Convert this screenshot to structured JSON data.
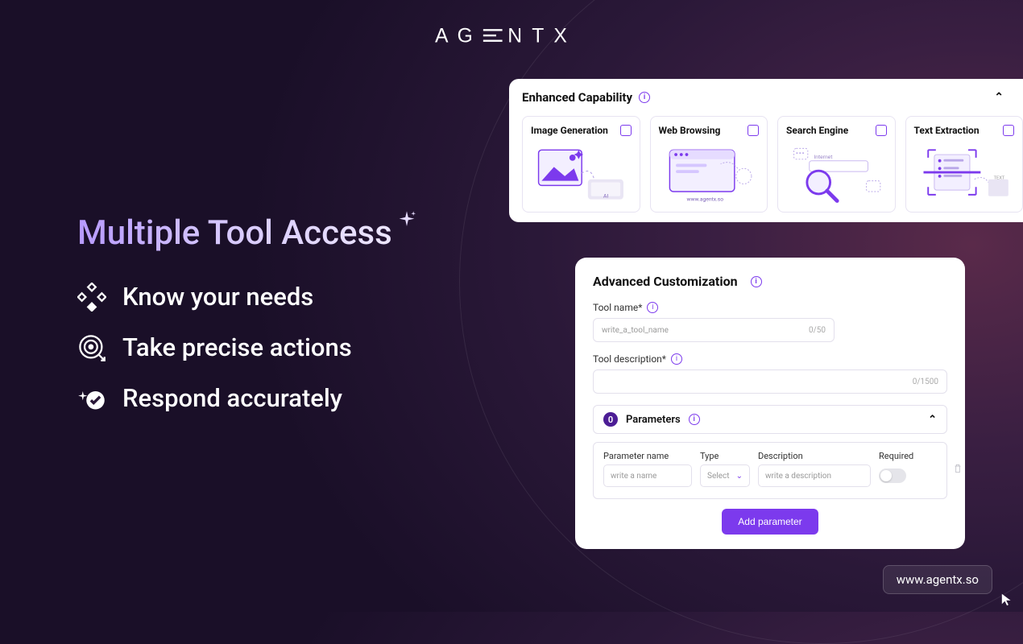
{
  "logo_text": "AGENTX",
  "headline": "Multiple Tool Access",
  "features": [
    {
      "text": "Know your needs"
    },
    {
      "text": "Take precise actions"
    },
    {
      "text": "Respond accurately"
    }
  ],
  "capability_panel": {
    "title": "Enhanced Capability",
    "cards": [
      {
        "label": "Image Generation",
        "sublabel": "AI"
      },
      {
        "label": "Web Browsing",
        "sublabel": "www.agentx.so"
      },
      {
        "label": "Search Engine",
        "sublabel": "Internet"
      },
      {
        "label": "Text Extraction",
        "sublabel": "TEXT"
      }
    ]
  },
  "adv_panel": {
    "title": "Advanced Customization",
    "tool_name_label": "Tool name*",
    "tool_name_placeholder": "write_a_tool_name",
    "tool_name_counter": "0/50",
    "tool_desc_label": "Tool description*",
    "tool_desc_counter": "0/1500",
    "params_title": "Parameters",
    "params_count": "0",
    "cols": {
      "name": "Parameter name",
      "type": "Type",
      "desc": "Description",
      "required": "Required"
    },
    "placeholders": {
      "name": "write a name",
      "type": "Select",
      "desc": "write a description"
    },
    "add_btn": "Add parameter"
  },
  "footer_url": "www.agentx.so"
}
